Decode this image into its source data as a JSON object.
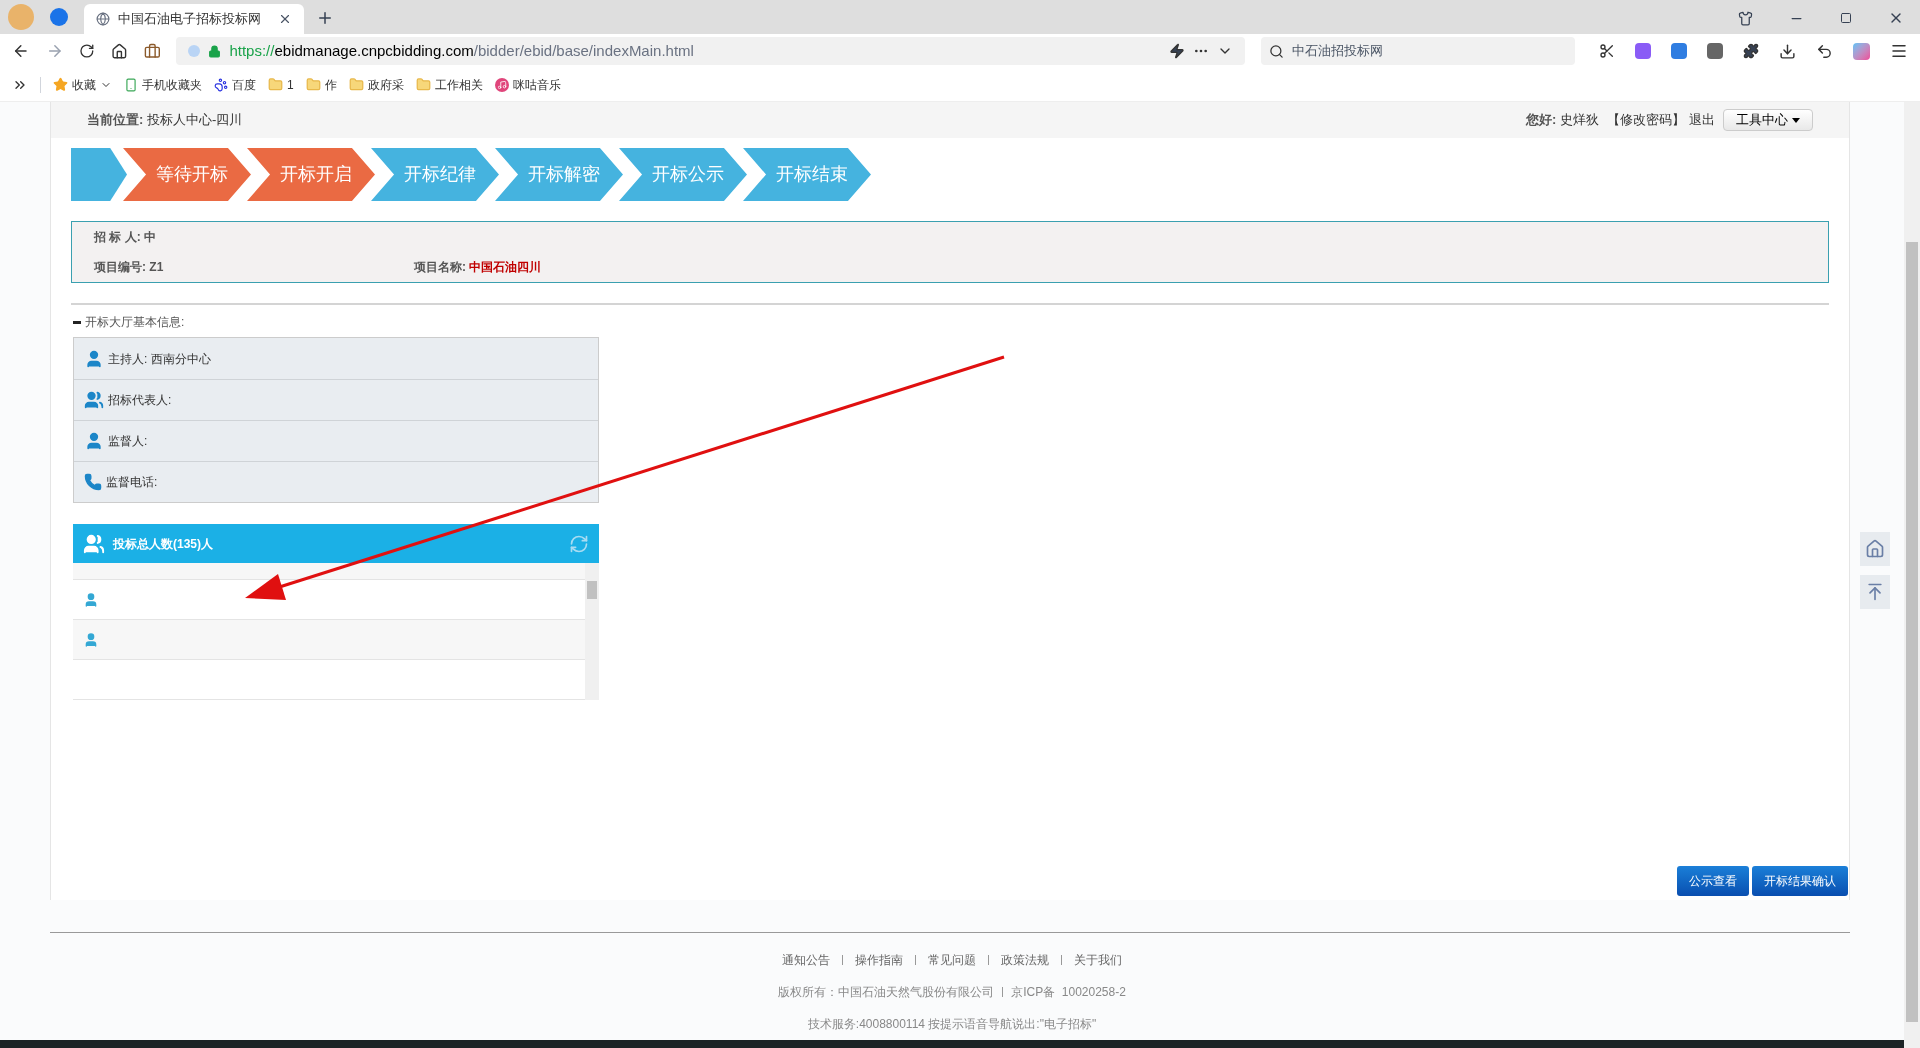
{
  "browser": {
    "tabs": [
      {
        "title": "中国石油电子招标投标网",
        "selected": true
      }
    ],
    "url": {
      "scheme": "https://",
      "host": "ebidmanage.cnpcbidding.com",
      "path": "/bidder/ebid/base/indexMain.html"
    },
    "search": {
      "placeholder": "中石油招投标网"
    },
    "bookmarks": [
      {
        "kind": "star",
        "label": "收藏"
      },
      {
        "kind": "phone",
        "label": "手机收藏夹"
      },
      {
        "kind": "paw",
        "label": "百度"
      },
      {
        "kind": "folder",
        "label": "1"
      },
      {
        "kind": "folder",
        "label": "作"
      },
      {
        "kind": "folder",
        "label": "政府采"
      },
      {
        "kind": "folder",
        "label": "工作相关"
      },
      {
        "kind": "music",
        "label": "咪咕音乐"
      }
    ]
  },
  "header": {
    "breadcrumb_label": "当前位置:",
    "breadcrumb": "投标人中心-四川",
    "greeting": "您好:",
    "user": "史烊狄",
    "change_password": "【修改密码】",
    "logout": "退出",
    "tools": "工具中心"
  },
  "steps": [
    {
      "done": false
    },
    {
      "label": "等待开标",
      "done": true
    },
    {
      "label": "开标开启",
      "done": true
    },
    {
      "label": "开标纪律",
      "done": false
    },
    {
      "label": "开标解密",
      "done": false
    },
    {
      "label": "开标公示",
      "done": false
    },
    {
      "label": "开标结束",
      "done": false
    }
  ],
  "project": [
    {
      "label": "招 标 人:",
      "value": "中",
      "emphasis": false
    },
    {
      "label": "项目编号:",
      "value": "Z1",
      "emphasis": false
    },
    {
      "label": "项目名称:",
      "value": "中国石油四川",
      "emphasis": true
    }
  ],
  "hall": {
    "title": "开标大厅基本信息:",
    "expanded": true,
    "items": [
      {
        "kind": "person",
        "label": "主持人:",
        "value": "西南分中心"
      },
      {
        "kind": "group",
        "label": "招标代表人:"
      },
      {
        "kind": "person",
        "label": "监督人:"
      },
      {
        "kind": "phone",
        "label": "监督电话:"
      }
    ]
  },
  "bidders": {
    "title": "投标总人数(135)人",
    "rows": [
      {
        "icon": false
      },
      {
        "icon": true
      },
      {
        "icon": true
      },
      {
        "icon": false
      }
    ]
  },
  "buttons": [
    "公示查看",
    "开标结果确认"
  ],
  "footer": {
    "links": [
      "通知公告",
      "操作指南",
      "常见问题",
      "政策法规",
      "关于我们"
    ],
    "copyright": "版权所有：中国石油天然气股份有限公司",
    "icp": "京ICP备  10020258-2",
    "support": "技术服务:4008800114 按提示语音导航说出:\"电子招标\""
  }
}
